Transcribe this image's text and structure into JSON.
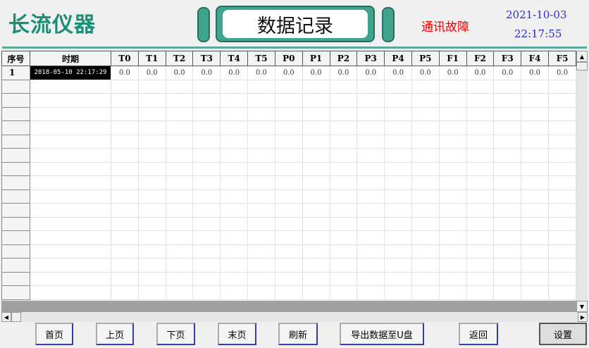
{
  "header": {
    "brand": "长流仪器",
    "title": "数据记录",
    "status": "通讯故障",
    "date": "2021-10-03",
    "time": "22:17:55"
  },
  "colors": {
    "accent": "#3fa48f",
    "brand": "#1a8f75",
    "status": "#ee0000",
    "datetime": "#2b2bd0"
  },
  "table": {
    "columns": [
      "序号",
      "时期",
      "T0",
      "T1",
      "T2",
      "T3",
      "T4",
      "T5",
      "P0",
      "P1",
      "P2",
      "P3",
      "P4",
      "P5",
      "F1",
      "F2",
      "F3",
      "F4",
      "F5"
    ],
    "rows": [
      [
        "1",
        "2018-05-10 22:17:29",
        "0.0",
        "0.0",
        "0.0",
        "0.0",
        "0.0",
        "0.0",
        "0.0",
        "0.0",
        "0.0",
        "0.0",
        "0.0",
        "0.0",
        "0.0",
        "0.0",
        "0.0",
        "0.0",
        "0.0"
      ]
    ],
    "empty_rows": 16
  },
  "buttons": {
    "first": "首页",
    "prev": "上页",
    "next": "下页",
    "last": "末页",
    "refresh": "刷新",
    "export": "导出数据至U盘",
    "back": "返回",
    "settings": "设置"
  }
}
